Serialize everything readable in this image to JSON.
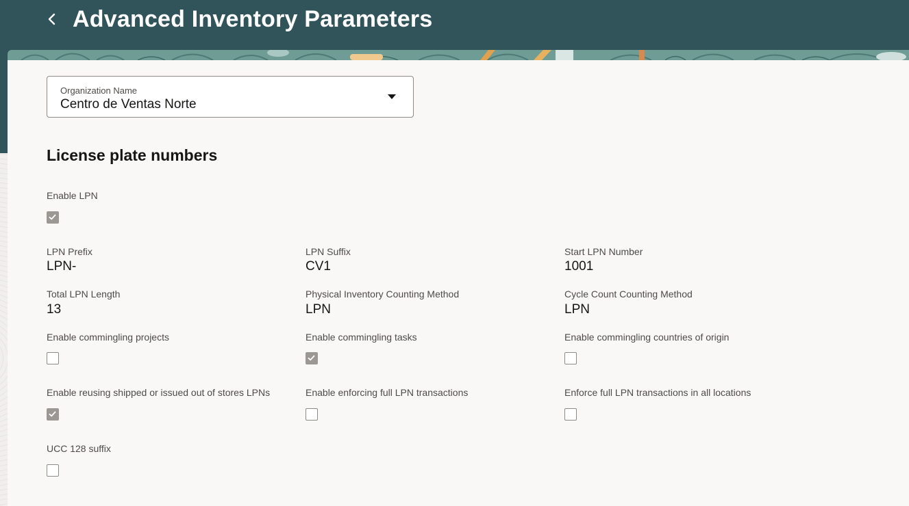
{
  "header": {
    "title": "Advanced Inventory Parameters",
    "back_icon": "chevron-left-icon"
  },
  "organization": {
    "label": "Organization Name",
    "value": "Centro de Ventas Norte",
    "dropdown_icon": "caret-down-icon"
  },
  "section": {
    "title": "License plate numbers"
  },
  "fields": {
    "enable_lpn": {
      "label": "Enable LPN",
      "checked": true
    },
    "lpn_prefix": {
      "label": "LPN Prefix",
      "value": "LPN-"
    },
    "lpn_suffix": {
      "label": "LPN Suffix",
      "value": "CV1"
    },
    "start_lpn_number": {
      "label": "Start LPN Number",
      "value": "1001"
    },
    "total_lpn_length": {
      "label": "Total LPN Length",
      "value": "13"
    },
    "physical_inventory_method": {
      "label": "Physical Inventory Counting Method",
      "value": "LPN"
    },
    "cycle_count_method": {
      "label": "Cycle Count Counting Method",
      "value": "LPN"
    },
    "commingling_projects": {
      "label": "Enable commingling projects",
      "checked": false
    },
    "commingling_tasks": {
      "label": "Enable commingling tasks",
      "checked": true
    },
    "commingling_countries": {
      "label": "Enable commingling countries of origin",
      "checked": false
    },
    "reusing_shipped": {
      "label": "Enable reusing shipped or issued out of stores LPNs",
      "checked": true
    },
    "enforcing_full_lpn": {
      "label": "Enable enforcing full LPN transactions",
      "checked": false
    },
    "enforce_all_locations": {
      "label": "Enforce full LPN transactions in all locations",
      "checked": false
    },
    "ucc_128_suffix": {
      "label": "UCC 128 suffix",
      "checked": false
    }
  },
  "colors": {
    "header_background": "#31535a",
    "page_background": "#f9f8f6",
    "checkbox_checked": "#9b9894"
  }
}
